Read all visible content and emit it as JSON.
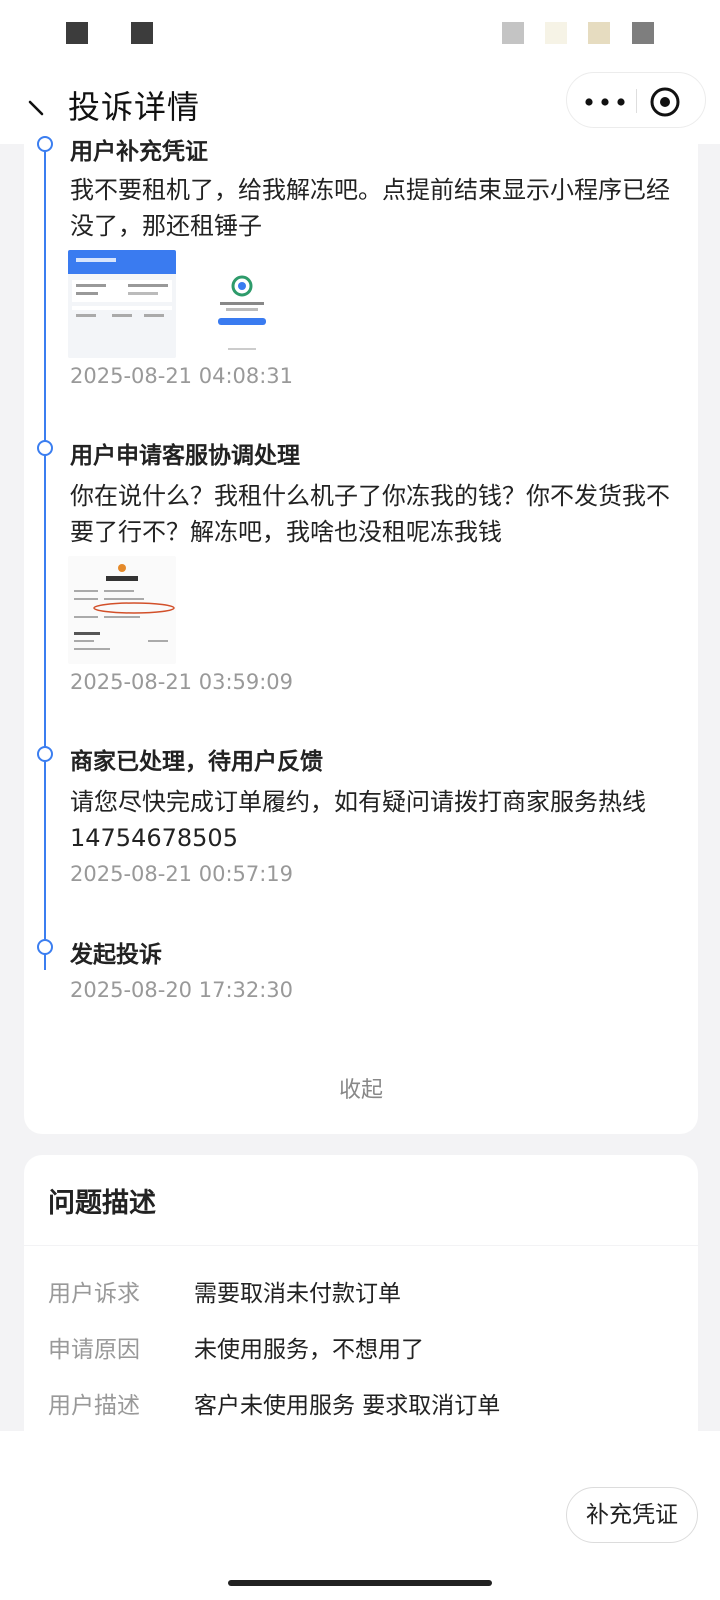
{
  "header": {
    "title": "投诉详情",
    "colors": {
      "accent": "#3b7ef0"
    }
  },
  "timeline": {
    "events": [
      {
        "title": "用户补充凭证",
        "text": "我不要租机了，给我解冻吧。点提前结束显示小程序已经没了，那还租锤子",
        "time": "2025-08-21 04:08:31"
      },
      {
        "title": "用户申请客服协调处理",
        "text": "你在说什么？我租什么机子了你冻我的钱？你不发货我不要了行不？解冻吧，我啥也没租呢冻我钱",
        "time": "2025-08-21 03:59:09"
      },
      {
        "title": "商家已处理，待用户反馈",
        "text": "请您尽快完成订单履约，如有疑问请拨打商家服务热线14754678505",
        "time": "2025-08-21 00:57:19"
      },
      {
        "title": "发起投诉",
        "time": "2025-08-20 17:32:30"
      }
    ],
    "collapse_label": "收起"
  },
  "problem": {
    "title": "问题描述",
    "rows": [
      {
        "label": "用户诉求",
        "value": "需要取消未付款订单"
      },
      {
        "label": "申请原因",
        "value": "未使用服务，不想用了"
      },
      {
        "label": "用户描述",
        "value": "客户未使用服务 要求取消订单"
      }
    ]
  },
  "footer": {
    "supplement_button": "补充凭证"
  }
}
